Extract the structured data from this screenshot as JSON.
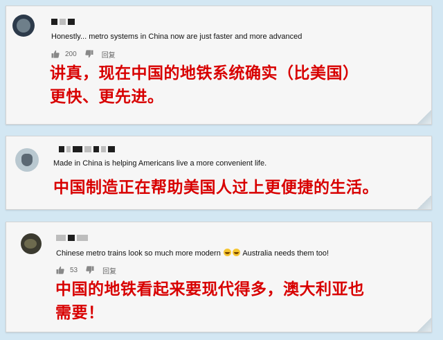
{
  "comments": [
    {
      "text": "Honestly... metro systems in China now are just faster and more advanced",
      "likes": "200",
      "reply_label": "回复",
      "translation_lines": [
        "讲真，现在中国的地铁系统确实（比美国）",
        "更快、更先进。"
      ]
    },
    {
      "text": "Made in China is helping Americans live a more convenient life.",
      "translation_lines": [
        "中国制造正在帮助美国人过上更便捷的生活。"
      ]
    },
    {
      "text_before": "Chinese metro trains look so much more modern",
      "text_after": "Australia needs them too!",
      "emoji": "grinning-sweat-emoji",
      "likes": "53",
      "reply_label": "回复",
      "translation_lines": [
        "中国的地铁看起来要现代得多，澳大利亚也",
        "需要！"
      ]
    }
  ],
  "colors": {
    "background": "#d3e7f3",
    "card": "#f6f6f6",
    "translation": "#d80000",
    "meta": "#666666"
  }
}
